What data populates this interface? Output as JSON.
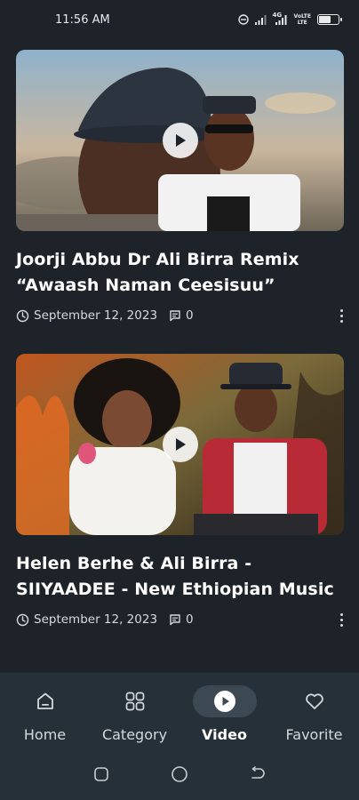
{
  "status_bar": {
    "time": "11:56 AM",
    "icons": [
      "dnd-icon",
      "signal-icon",
      "signal-4g-icon",
      "wifi-data-icon",
      "battery-icon"
    ],
    "lte_label": "4G",
    "volte_label": "VoLTE",
    "net_label": "LTE"
  },
  "videos": [
    {
      "title": "Joorji Abbu Dr Ali Birra Remix “Awaash Naman Ceesisuu”",
      "date": "September 12, 2023",
      "comments": "0"
    },
    {
      "title": "Helen Berhe & Ali Birra - SIIYAADEE - New Ethiopian Music",
      "date": "September 12, 2023",
      "comments": "0"
    }
  ],
  "bottom_nav": {
    "items": [
      {
        "label": "Home",
        "icon": "home-icon",
        "active": false
      },
      {
        "label": "Category",
        "icon": "grid-icon",
        "active": false
      },
      {
        "label": "Video",
        "icon": "play-circle-icon",
        "active": true
      },
      {
        "label": "Favorite",
        "icon": "heart-icon",
        "active": false
      }
    ]
  },
  "colors": {
    "background": "#1d2328",
    "nav_background": "#263038",
    "active_pill": "#3c4852",
    "text": "#ffffff",
    "muted_text": "#d6dadd"
  }
}
